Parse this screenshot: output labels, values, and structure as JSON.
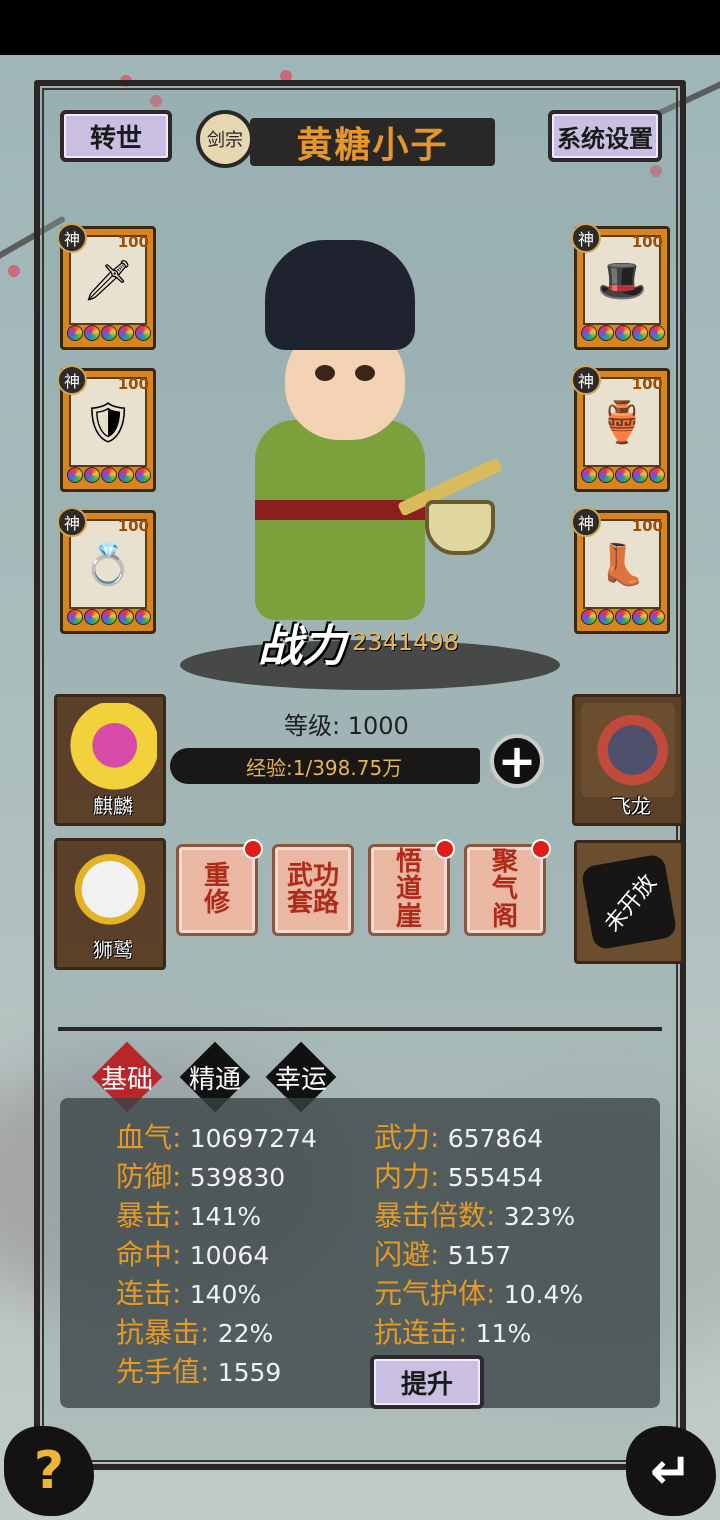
{
  "header": {
    "rebirth_label": "转世",
    "sect_label": "剑宗",
    "player_name": "黄糖小子",
    "settings_label": "系统设置"
  },
  "equipment": {
    "grade_label": "神",
    "slots": [
      {
        "level": "100",
        "icon": "sword-icon"
      },
      {
        "level": "100",
        "icon": "armor-icon"
      },
      {
        "level": "100",
        "icon": "ring-icon"
      },
      {
        "level": "100",
        "icon": "hat-icon"
      },
      {
        "level": "100",
        "icon": "gourd-icon"
      },
      {
        "level": "100",
        "icon": "boots-icon"
      }
    ]
  },
  "combat_power": {
    "label": "战力",
    "value": "2341498"
  },
  "level": {
    "text": "等级: 1000"
  },
  "experience": {
    "text": "经验:1/398.75万"
  },
  "pets": {
    "qilin": "麒麟",
    "dragon": "飞龙",
    "griffin": "狮鹫",
    "locked": "未开放"
  },
  "skills": [
    {
      "label": "重修",
      "has_alert": true
    },
    {
      "label": "武功套路",
      "has_alert": false
    },
    {
      "label": "悟道崖",
      "has_alert": true
    },
    {
      "label": "聚气阁",
      "has_alert": true
    }
  ],
  "tabs": [
    "基础",
    "精通",
    "幸运"
  ],
  "stats": {
    "left": [
      {
        "k": "血气:",
        "v": "10697274"
      },
      {
        "k": "防御:",
        "v": "539830"
      },
      {
        "k": "暴击:",
        "v": "141%"
      },
      {
        "k": "命中:",
        "v": "10064"
      },
      {
        "k": "连击:",
        "v": "140%"
      },
      {
        "k": "抗暴击:",
        "v": "22%"
      },
      {
        "k": "先手值:",
        "v": "1559"
      }
    ],
    "right": [
      {
        "k": "武力:",
        "v": "657864"
      },
      {
        "k": "内力:",
        "v": "555454"
      },
      {
        "k": "暴击倍数:",
        "v": "323%"
      },
      {
        "k": "闪避:",
        "v": "5157"
      },
      {
        "k": "元气护体:",
        "v": "10.4%"
      },
      {
        "k": "抗连击:",
        "v": "11%"
      }
    ]
  },
  "upgrade_label": "提升",
  "footer": {
    "help_label": "?",
    "back_icon": "back-arrow-icon"
  }
}
